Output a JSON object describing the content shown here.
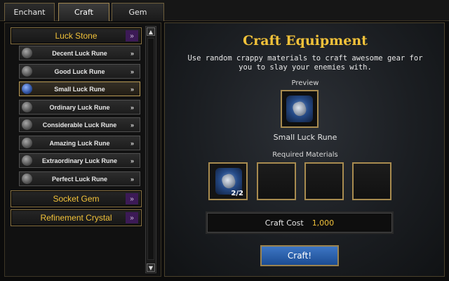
{
  "tabs": [
    {
      "label": "Enchant",
      "active": false
    },
    {
      "label": "Craft",
      "active": true
    },
    {
      "label": "Gem",
      "active": false
    }
  ],
  "sidebar": {
    "categories": [
      {
        "label": "Luck Stone",
        "arrow": "»"
      },
      {
        "label": "Socket Gem",
        "arrow": "»"
      },
      {
        "label": "Refinement Crystal",
        "arrow": "»"
      }
    ],
    "items": [
      {
        "label": "Decent Luck Rune",
        "arrow": "»"
      },
      {
        "label": "Good Luck Rune",
        "arrow": "»"
      },
      {
        "label": "Small Luck Rune",
        "arrow": "»",
        "selected": true
      },
      {
        "label": "Ordinary Luck Rune",
        "arrow": "»"
      },
      {
        "label": "Considerable Luck Rune",
        "arrow": "»"
      },
      {
        "label": "Amazing Luck Rune",
        "arrow": "»"
      },
      {
        "label": "Extraordinary Luck Rune",
        "arrow": "»"
      },
      {
        "label": "Perfect Luck Rune",
        "arrow": "»"
      }
    ],
    "scroll_up": "▲",
    "scroll_down": "▼"
  },
  "main": {
    "title": "Craft Equipment",
    "description": "Use random crappy materials to craft awesome gear for you to slay your enemies with.",
    "preview_label": "Preview",
    "preview_item": "Small Luck Rune",
    "required_label": "Required Materials",
    "materials": [
      {
        "filled": true,
        "qty": "2/2"
      },
      {
        "filled": false,
        "qty": ""
      },
      {
        "filled": false,
        "qty": ""
      },
      {
        "filled": false,
        "qty": ""
      }
    ],
    "cost_label": "Craft Cost",
    "cost_value": "1,000",
    "craft_button": "Craft!"
  },
  "colors": {
    "accent_gold": "#f2c23a",
    "button_blue": "#2a63b0",
    "category_chevron": "#3c1a56"
  }
}
